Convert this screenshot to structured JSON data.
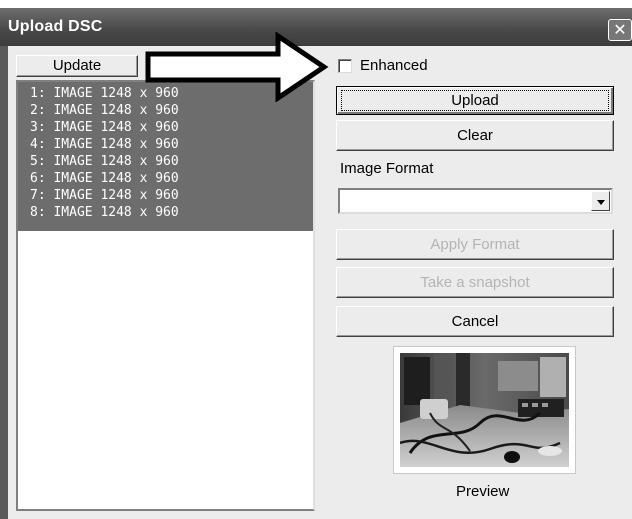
{
  "window": {
    "title": "Upload DSC",
    "close_glyph": "✕"
  },
  "toolbar": {
    "update_label": "Update"
  },
  "images": [
    "1: IMAGE 1248 x 960",
    "2: IMAGE 1248 x 960",
    "3: IMAGE 1248 x 960",
    "4: IMAGE 1248 x 960",
    "5: IMAGE 1248 x 960",
    "6: IMAGE 1248 x 960",
    "7: IMAGE 1248 x 960",
    "8: IMAGE 1248 x 960"
  ],
  "options": {
    "enhanced_label": "Enhanced",
    "enhanced_checked": false
  },
  "actions": {
    "upload": "Upload",
    "clear": "Clear",
    "apply_format": "Apply Format",
    "snapshot": "Take a snapshot",
    "cancel": "Cancel"
  },
  "format": {
    "label": "Image Format",
    "selected": ""
  },
  "preview": {
    "label": "Preview"
  },
  "icons": {
    "pointer": "arrow-annotation-icon",
    "dropdown": "chevron-down-icon",
    "close": "close-icon"
  }
}
